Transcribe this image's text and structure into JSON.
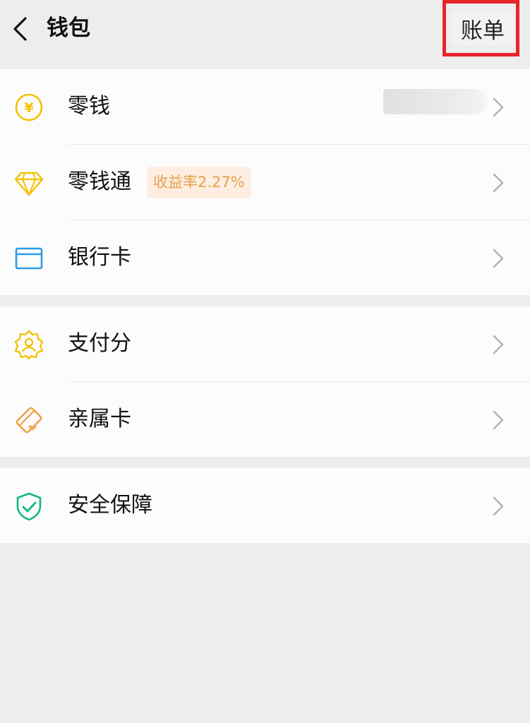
{
  "header": {
    "title": "钱包",
    "bill_label": "账单"
  },
  "groups": [
    {
      "items": [
        {
          "label": "零钱",
          "icon": "yuan-coin-icon"
        },
        {
          "label": "零钱通",
          "icon": "diamond-icon",
          "badge": "收益率2.27%"
        },
        {
          "label": "银行卡",
          "icon": "bank-card-icon"
        }
      ]
    },
    {
      "items": [
        {
          "label": "支付分",
          "icon": "credit-score-badge-icon"
        },
        {
          "label": "亲属卡",
          "icon": "family-card-icon"
        }
      ]
    },
    {
      "items": [
        {
          "label": "安全保障",
          "icon": "shield-check-icon"
        }
      ]
    }
  ],
  "colors": {
    "background": "#ededed",
    "surface": "#fdfcfd",
    "highlight_box": "#e8232a",
    "badge_text": "#e4a14d",
    "badge_bg": "#fdeee1",
    "yellow_icon": "#f2c100",
    "blue_icon": "#2b9de5",
    "orange_icon": "#f0a24a",
    "green_icon": "#14b684"
  }
}
